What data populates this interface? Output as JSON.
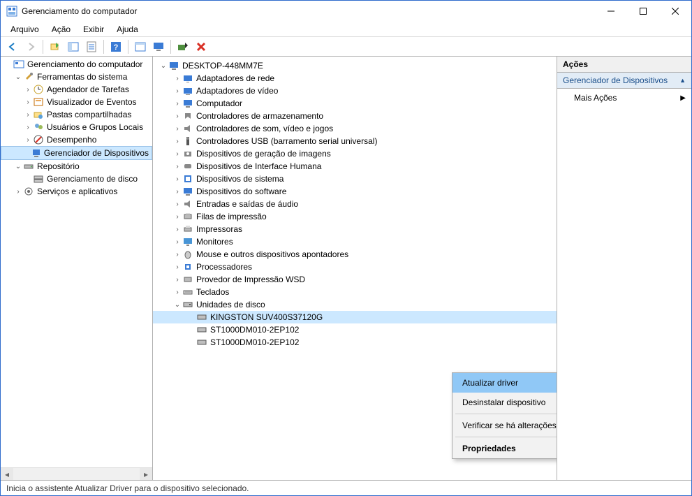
{
  "window": {
    "title": "Gerenciamento do computador"
  },
  "menu": {
    "items": [
      "Arquivo",
      "Ação",
      "Exibir",
      "Ajuda"
    ]
  },
  "left_tree": {
    "root": "Gerenciamento do computador",
    "tools": "Ferramentas do sistema",
    "tools_items": [
      "Agendador de Tarefas",
      "Visualizador de Eventos",
      "Pastas compartilhadas",
      "Usuários e Grupos Locais",
      "Desempenho",
      "Gerenciador de Dispositivos"
    ],
    "repo": "Repositório",
    "repo_item": "Gerenciamento de disco",
    "services": "Serviços e aplicativos"
  },
  "device_tree": {
    "root": "DESKTOP-448MM7E",
    "categories": [
      "Adaptadores de rede",
      "Adaptadores de vídeo",
      "Computador",
      "Controladores de armazenamento",
      "Controladores de som, vídeo e jogos",
      "Controladores USB (barramento serial universal)",
      "Dispositivos de geração de imagens",
      "Dispositivos de Interface Humana",
      "Dispositivos de sistema",
      "Dispositivos do software",
      "Entradas e saídas de áudio",
      "Filas de impressão",
      "Impressoras",
      "Monitores",
      "Mouse e outros dispositivos apontadores",
      "Processadores",
      "Provedor de Impressão WSD",
      "Teclados"
    ],
    "disk_cat": "Unidades de disco",
    "disks": [
      "KINGSTON SUV400S37120G",
      "ST1000DM010-2EP102",
      "ST1000DM010-2EP102"
    ]
  },
  "context_menu": {
    "items": [
      "Atualizar driver",
      "Desinstalar dispositivo",
      "Verificar se há alterações de hardware",
      "Propriedades"
    ]
  },
  "actions_pane": {
    "header": "Ações",
    "sub": "Gerenciador de Dispositivos",
    "more": "Mais Ações"
  },
  "statusbar": "Inicia o assistente Atualizar Driver para o dispositivo selecionado."
}
